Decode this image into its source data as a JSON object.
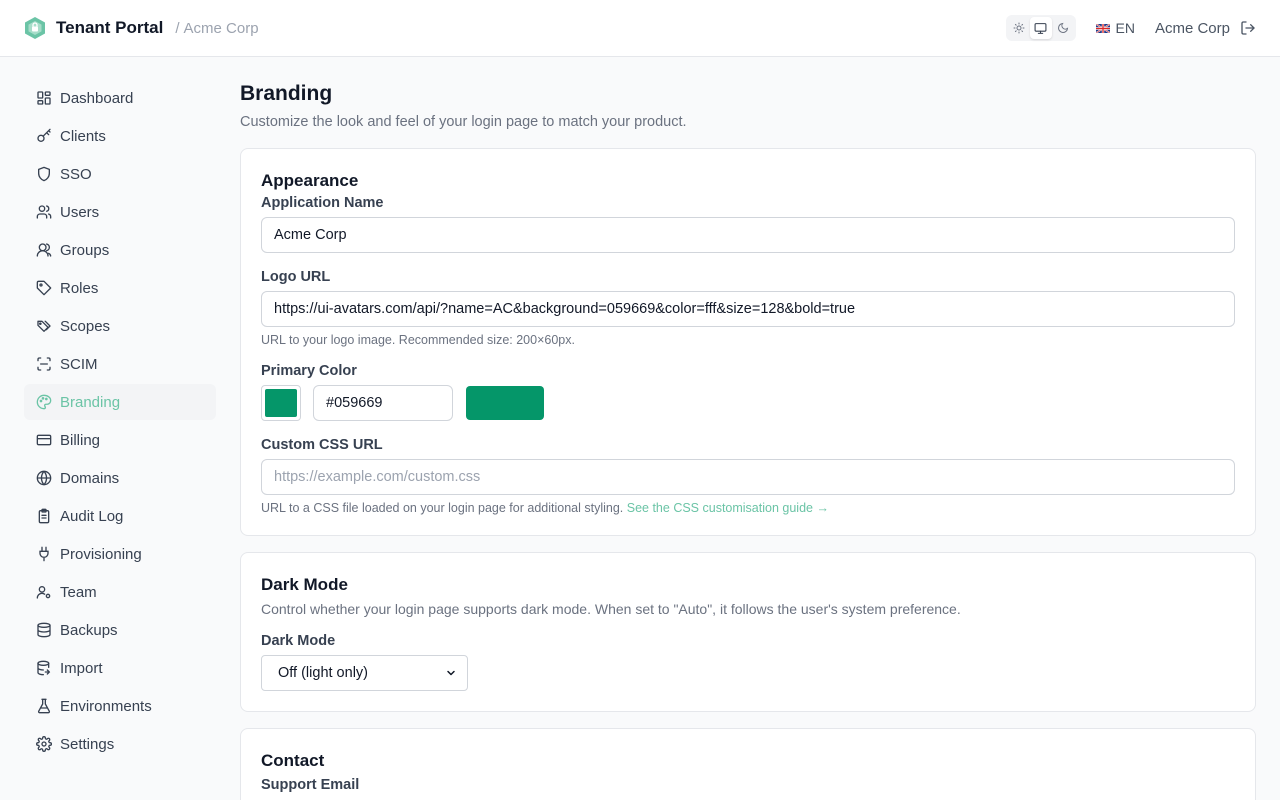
{
  "header": {
    "app_name": "Tenant Portal",
    "separator": "/",
    "tenant": "Acme Corp",
    "language": "EN",
    "user": "Acme Corp"
  },
  "theme_options": [
    "light",
    "system",
    "dark"
  ],
  "theme_selected": "system",
  "sidebar": {
    "items": [
      {
        "label": "Dashboard",
        "icon": "dashboard-icon"
      },
      {
        "label": "Clients",
        "icon": "key-icon"
      },
      {
        "label": "SSO",
        "icon": "shield-icon"
      },
      {
        "label": "Users",
        "icon": "users-icon"
      },
      {
        "label": "Groups",
        "icon": "group-icon"
      },
      {
        "label": "Roles",
        "icon": "tag-icon"
      },
      {
        "label": "Scopes",
        "icon": "tags-icon"
      },
      {
        "label": "SCIM",
        "icon": "scan-icon"
      },
      {
        "label": "Branding",
        "icon": "palette-icon",
        "active": true
      },
      {
        "label": "Billing",
        "icon": "credit-card-icon"
      },
      {
        "label": "Domains",
        "icon": "globe-icon"
      },
      {
        "label": "Audit Log",
        "icon": "clipboard-icon"
      },
      {
        "label": "Provisioning",
        "icon": "plug-icon"
      },
      {
        "label": "Team",
        "icon": "user-cog-icon"
      },
      {
        "label": "Backups",
        "icon": "database-icon"
      },
      {
        "label": "Import",
        "icon": "database-import-icon"
      },
      {
        "label": "Environments",
        "icon": "flask-icon"
      },
      {
        "label": "Settings",
        "icon": "gear-icon"
      }
    ]
  },
  "page": {
    "title": "Branding",
    "subtitle": "Customize the look and feel of your login page to match your product."
  },
  "appearance": {
    "title": "Appearance",
    "app_name_label": "Application Name",
    "app_name_value": "Acme Corp",
    "logo_label": "Logo URL",
    "logo_value": "https://ui-avatars.com/api/?name=AC&background=059669&color=fff&size=128&bold=true",
    "logo_help": "URL to your logo image. Recommended size: 200×60px.",
    "color_label": "Primary Color",
    "color_value": "#059669",
    "css_label": "Custom CSS URL",
    "css_placeholder": "https://example.com/custom.css",
    "css_help": "URL to a CSS file loaded on your login page for additional styling.",
    "css_help_link": "See the CSS customisation guide →"
  },
  "dark_mode": {
    "title": "Dark Mode",
    "description": "Control whether your login page supports dark mode. When set to \"Auto\", it follows the user's system preference.",
    "label": "Dark Mode",
    "selected": "Off (light only)"
  },
  "contact": {
    "title": "Contact",
    "support_email_label": "Support Email"
  },
  "colors": {
    "primary": "#059669",
    "accent_text": "#6bc4a6",
    "logo": "#6bc4a6"
  }
}
